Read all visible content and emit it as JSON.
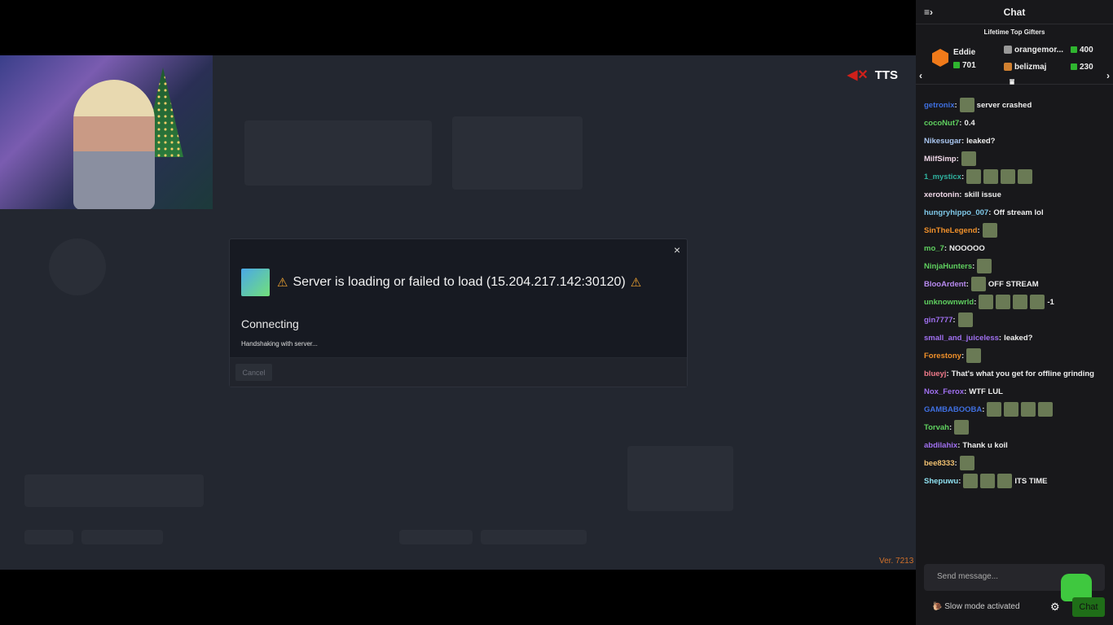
{
  "overlay": {
    "tts_label": "TTS",
    "tts_icon": "speaker-muted-icon",
    "version": "Ver. 7213"
  },
  "modal": {
    "title": "Server is loading or failed to load (15.204.217.142:30120)",
    "status": "Connecting",
    "substatus": "Handshaking with server...",
    "cancel": "Cancel",
    "close": "×",
    "warning_icon": "⚠"
  },
  "chat": {
    "title": "Chat",
    "top_gifters": {
      "label": "Lifetime Top Gifters",
      "first": {
        "name": "Eddie",
        "count": "701"
      },
      "others": [
        {
          "name": "orangemor...",
          "count": "400"
        },
        {
          "name": "belizmaj",
          "count": "230"
        }
      ]
    },
    "messages": [
      {
        "user": "getronix",
        "color": "#3f6fe0",
        "text": "server crashed",
        "emotes": 1
      },
      {
        "user": "cocoNut7",
        "color": "#5fd05f",
        "text": "0.4",
        "emotes": 0
      },
      {
        "user": "Nikesugar",
        "color": "#a9c6f0",
        "text": "leaked?",
        "emotes": 0
      },
      {
        "user": "MilfSimp",
        "color": "#f0d8e8",
        "text": "",
        "emotes": 1
      },
      {
        "user": "1_mysticx",
        "color": "#2fb3a0",
        "text": "",
        "emotes": 4
      },
      {
        "user": "xerotonin",
        "color": "#f0d8e8",
        "text": "skill issue",
        "emotes": 0
      },
      {
        "user": "hungryhippo_007",
        "color": "#7fc8e8",
        "text": "Off stream lol",
        "emotes": 0
      },
      {
        "user": "SinTheLegend",
        "color": "#f0902a",
        "text": "",
        "emotes": 1
      },
      {
        "user": "mo_7",
        "color": "#5fd05f",
        "text": "NOOOOO",
        "emotes": 0
      },
      {
        "user": "NinjaHunters",
        "color": "#5fd05f",
        "text": "",
        "emotes": 1
      },
      {
        "user": "BlooArdent",
        "color": "#b88af0",
        "text": "OFF STREAM",
        "emotes": 1
      },
      {
        "user": "unknownwrld",
        "color": "#5fd05f",
        "text": "-1",
        "emotes": 4
      },
      {
        "user": "gin7777",
        "color": "#a070f0",
        "text": "",
        "emotes": 1
      },
      {
        "user": "small_and_juiceless",
        "color": "#a070f0",
        "text": "leaked?",
        "emotes": 0
      },
      {
        "user": "Forestony",
        "color": "#f0902a",
        "text": "",
        "emotes": 1
      },
      {
        "user": "blueyj",
        "color": "#f07a8a",
        "text": "That's what you get for offline grinding",
        "emotes": 0
      },
      {
        "user": "Nox_Ferox",
        "color": "#a070f0",
        "text": "WTF LUL",
        "emotes": 0
      },
      {
        "user": "GAMBABOOBA",
        "color": "#3f6fe0",
        "text": "",
        "emotes": 4
      },
      {
        "user": "Torvah",
        "color": "#5fd05f",
        "text": "",
        "emotes": 1
      },
      {
        "user": "abdilahix",
        "color": "#a070f0",
        "text": "Thank u koil",
        "emotes": 0
      },
      {
        "user": "bee8333",
        "color": "#f0c070",
        "text": "",
        "emotes": 1
      },
      {
        "user": "Shepuwu",
        "color": "#8fe0f0",
        "text": "ITS TIME",
        "emotes": 3
      }
    ],
    "input_placeholder": "Send message...",
    "slow_mode": "Slow mode activated",
    "send_button": "Chat"
  }
}
